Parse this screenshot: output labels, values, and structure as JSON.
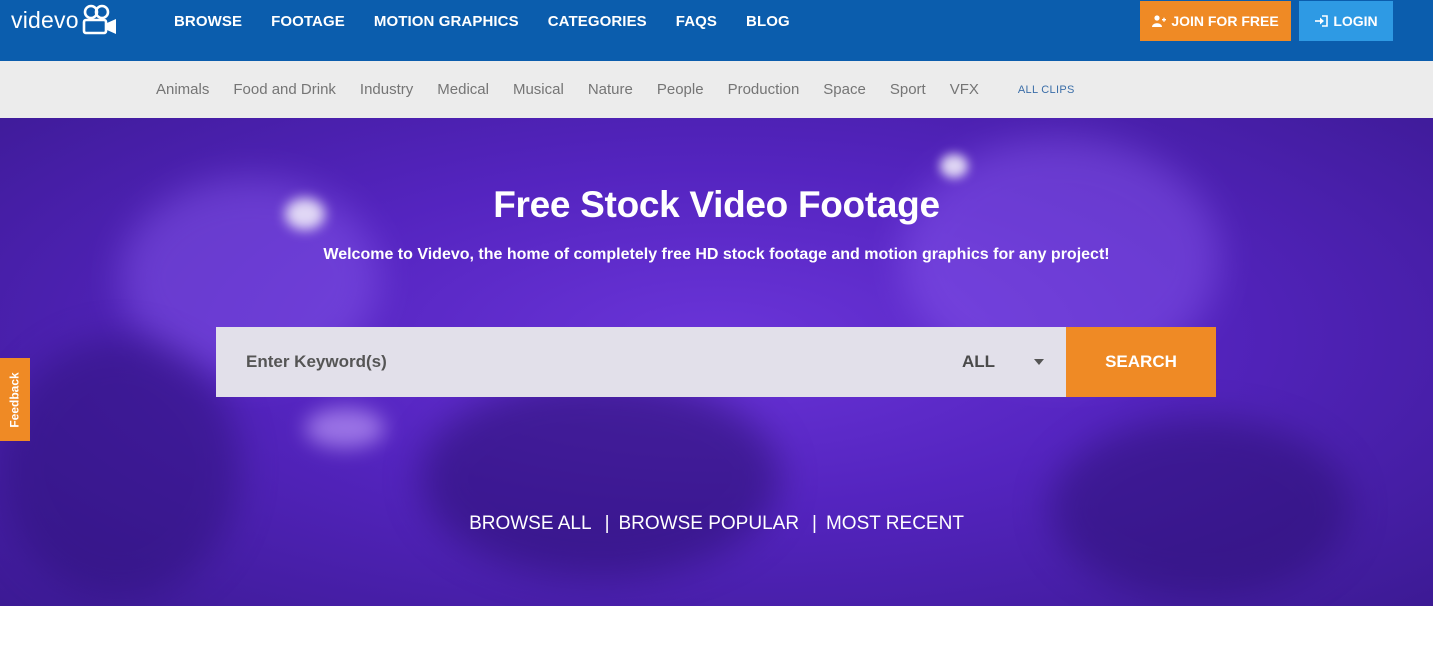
{
  "brand": {
    "name": "videvo",
    "icon": "camera-icon",
    "color": "#0b5dad"
  },
  "nav": {
    "items": [
      "BROWSE",
      "FOOTAGE",
      "MOTION GRAPHICS",
      "CATEGORIES",
      "FAQS",
      "BLOG"
    ]
  },
  "auth": {
    "join_label": "JOIN FOR FREE",
    "join_icon": "user-plus-icon",
    "join_color": "#ef8a25",
    "login_label": "LOGIN",
    "login_icon": "sign-in-icon",
    "login_color": "#2e9ae4"
  },
  "categories": {
    "items": [
      "Animals",
      "Food and Drink",
      "Industry",
      "Medical",
      "Musical",
      "Nature",
      "People",
      "Production",
      "Space",
      "Sport",
      "VFX"
    ],
    "all_clips": "ALL CLIPS"
  },
  "hero": {
    "title": "Free Stock Video Footage",
    "subtitle": "Welcome to Videvo, the home of completely free HD stock footage and motion graphics for any project!"
  },
  "search": {
    "placeholder": "Enter Keyword(s)",
    "value": "",
    "filter_selected": "ALL",
    "button_label": "SEARCH",
    "button_color": "#ef8a25"
  },
  "browse_links": {
    "all": "BROWSE ALL",
    "popular": "BROWSE POPULAR",
    "recent": "MOST RECENT",
    "separator": "|"
  },
  "feedback": {
    "label": "Feedback"
  }
}
